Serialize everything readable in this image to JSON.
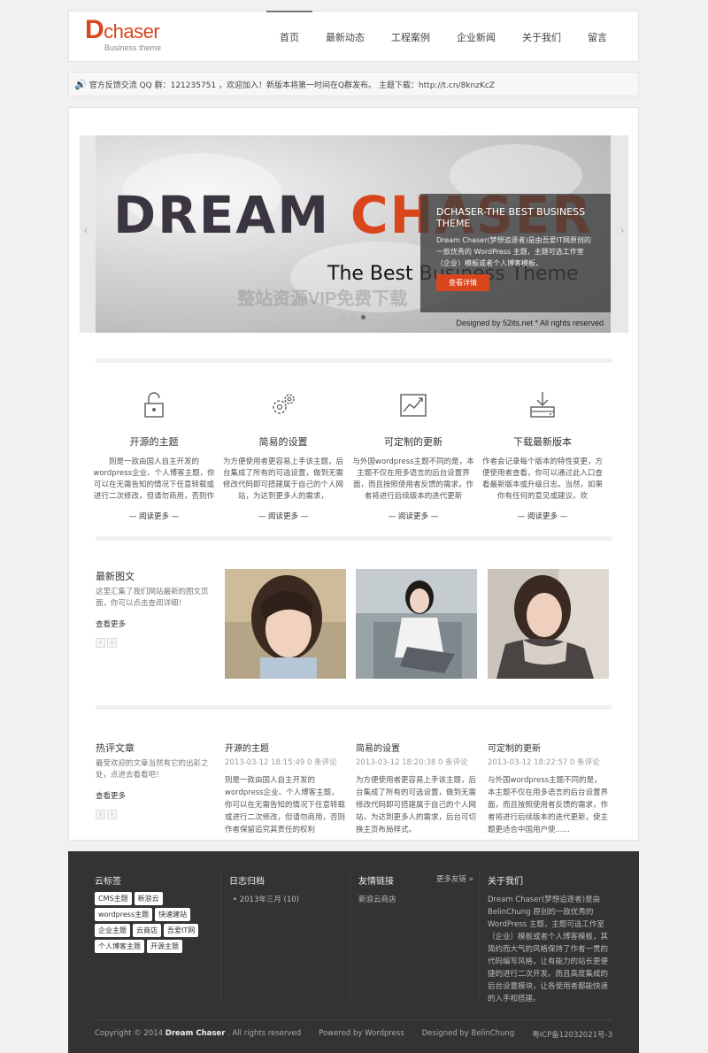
{
  "brand": {
    "logo_initial": "D",
    "logo_text": "chaser",
    "logo_sub": "Business theme",
    "accent": "#d9461c"
  },
  "nav": [
    {
      "label": "首页",
      "active": true
    },
    {
      "label": "最新动态"
    },
    {
      "label": "工程案例"
    },
    {
      "label": "企业新闻"
    },
    {
      "label": "关于我们"
    },
    {
      "label": "留言"
    }
  ],
  "notice": {
    "icon": "speaker-icon",
    "text": "官方反馈交流 QQ 群：121235751 ，欢迎加入！新版本将第一时间在Q群发布。 主题下载：http://t.cn/8knzKcZ"
  },
  "slider": {
    "hero_word1": "DREAM",
    "hero_word2": "CHASER",
    "hero_tagline": "The Best Business Theme",
    "watermark": "整站资源VIP免费下载",
    "credit": "Designed by 52its.net * All rights reserved",
    "caption_title": "DCHASER-THE BEST BUSINESS THEME",
    "caption_text": "Dream Chaser(梦想追逐者)是由吾爱IT网原创的一款优秀的 WordPress 主题，主题可选工作室（企业）模板或者个人博客模板，",
    "caption_button": "查看详情",
    "prev": "‹",
    "next": "›",
    "active_slide": 3,
    "total_slides": 3
  },
  "features": [
    {
      "icon": "unlock-icon",
      "title": "开源的主题",
      "text": "则是一款由国人自主开发的wordpress企业、个人博客主题，你可以在无需告知的情况下任意转载或进行二次修改，但请勿商用，否则作",
      "more": "— 阅读更多 —"
    },
    {
      "icon": "gears-icon",
      "title": "简易的设置",
      "text": "为方便使用者更容易上手该主题，后台集成了所有的可选设置，做到无需修改代码即可搭建属于自己的个人网站，为达到更多人的需求，",
      "more": "— 阅读更多 —"
    },
    {
      "icon": "chart-icon",
      "title": "可定制的更新",
      "text": "与外国wordpress主题不同的是，本主题不仅在用多语言的后台设置界面，而且按照使用者反馈的需求，作者将进行后续版本的迭代更新",
      "more": "— 阅读更多 —"
    },
    {
      "icon": "download-icon",
      "title": "下载最新版本",
      "text": "作者会记录每个版本的特性变更，方便使用者查看，你可以通过此入口查看最新版本或升级日志。当然，如果你有任何的意见或建议，欢",
      "more": "— 阅读更多 —"
    }
  ],
  "photos_section": {
    "title": "最新图文",
    "desc": "这里汇集了我们网站最新的图文页面，你可以点击查阅详细！",
    "more": "查看更多",
    "prev": "‹",
    "next": "›"
  },
  "articles_section": {
    "title": "热评文章",
    "desc": "最受欢迎的文章当然有它的出彩之处，点进去看看吧！",
    "more": "查看更多",
    "prev": "‹",
    "next": "›"
  },
  "articles": [
    {
      "title": "开源的主题",
      "meta": "2013-03-12 18:15:49 0 条评论",
      "text": "则是一款由国人自主开发的wordpress企业、个人博客主题，你可以在无需告知的情况下任意转载或进行二次修改，但请勿商用，否则作者保留追究其责任的权利"
    },
    {
      "title": "简易的设置",
      "meta": "2013-03-12 18:20:38 0 条评论",
      "text": "为方便使用者更容易上手该主题，后台集成了所有的可选设置，做到无需修改代码即可搭建属于自己的个人网站，为达到更多人的需求，后台可切换主页布局样式。"
    },
    {
      "title": "可定制的更新",
      "meta": "2013-03-12 18:22:57 0 条评论",
      "text": "与外国wordpress主题不同的是，本主题不仅在用多语言的后台设置界面，而且按照使用者反馈的需求，作者将进行后续版本的迭代更新，使主题更适合中国用户使......"
    }
  ],
  "footer": {
    "tags_title": "云标签",
    "tags": [
      "CMS主题",
      "新浪云",
      "wordpress主题",
      "快速建站",
      "企业主题",
      "云商店",
      "吾爱IT网",
      "个人博客主题",
      "开源主题"
    ],
    "archive_title": "日志归档",
    "archive_item": "2013年三月 (10)",
    "links_title": "友情链接",
    "links_more": "更多友链 »",
    "link_item": "新浪云商店",
    "about_title": "关于我们",
    "about_text": "Dream Chaser(梦想追逐者)是由BelinChung 原创的一款优秀的 WordPress 主题，主题可选工作室（企业）模板或者个人博客模板，其简约而大气的风格保持了作者一贯的代码编写风格，让有能力的站长更便捷的进行二次开发。而且高度集成的后台设置模块，让各使用者都能快速的入手和搭建。",
    "copyright_prefix": "Copyright © 2014",
    "copyright_name": "Dream Chaser",
    "copyright_suffix": ". All rights reserved",
    "powered_prefix": "Powered by",
    "powered_name": "Wordpress",
    "designed_prefix": "Designed by",
    "designed_name": "BelinChung",
    "icp": "粤ICP备12032021号-3"
  }
}
